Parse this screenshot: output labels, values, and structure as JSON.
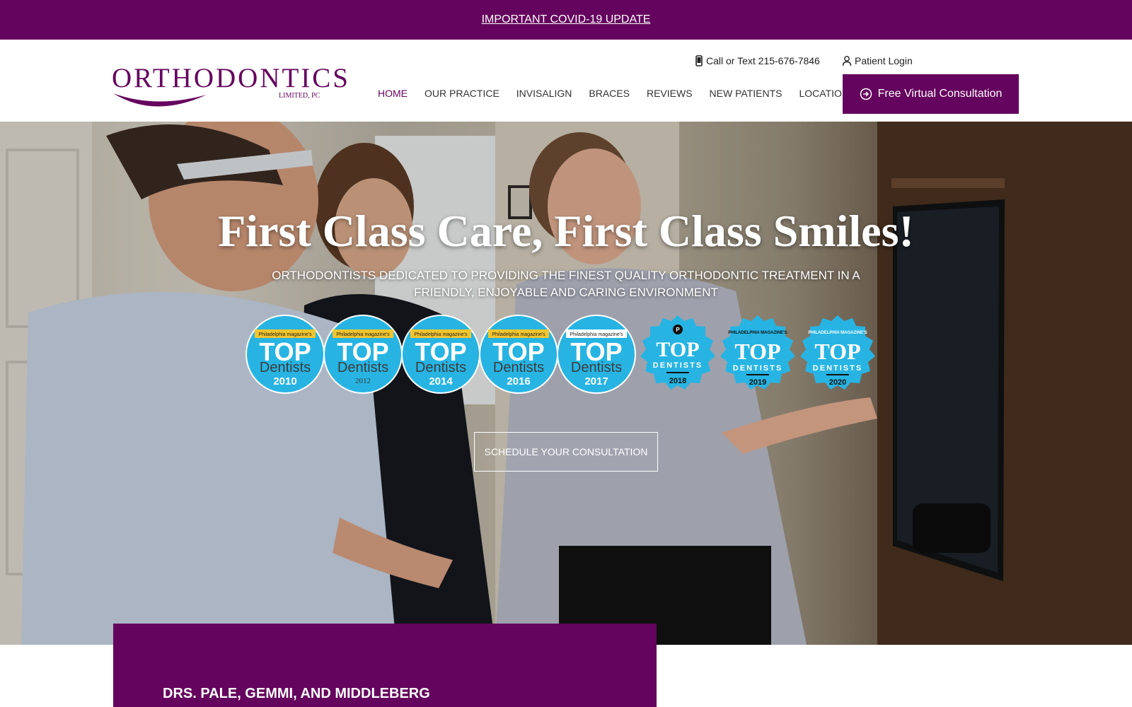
{
  "announcement": {
    "label": "IMPORTANT COVID-19 UPDATE"
  },
  "brand": {
    "logo_main": "ORTHODONTICS",
    "logo_sub": "LIMITED, PC",
    "primary_color": "#65045e",
    "badge_color": "#27b4e3",
    "badge_gold": "#f2c52e"
  },
  "utility": {
    "call_label": "Call or Text 215-676-7846",
    "call_icon": "phone-icon",
    "login_label": "Patient Login",
    "login_icon": "user-icon"
  },
  "nav": {
    "items": [
      {
        "label": "HOME",
        "active": true
      },
      {
        "label": "OUR PRACTICE"
      },
      {
        "label": "INVISALIGN"
      },
      {
        "label": "BRACES"
      },
      {
        "label": "REVIEWS"
      },
      {
        "label": "NEW PATIENTS"
      },
      {
        "label": "LOCATIONS"
      }
    ],
    "cta_label": "Free Virtual Consultation",
    "cta_icon": "arrow-circle-icon"
  },
  "hero": {
    "title": "First Class Care, First Class Smiles!",
    "subtitle": "ORTHODONTISTS DEDICATED TO PROVIDING THE FINEST QUALITY ORTHODONTIC TREATMENT IN A FRIENDLY, ENJOYABLE AND CARING ENVIRONMENT",
    "button_label": "SCHEDULE YOUR CONSULTATION",
    "badges": [
      {
        "publisher": "Philadelphia magazine's",
        "top": "TOP",
        "word": "Dentists",
        "year": "2010"
      },
      {
        "publisher": "Philadelphia magazine's",
        "top": "TOP",
        "word": "Dentists",
        "year": "2012"
      },
      {
        "publisher": "Philadelphia magazine's",
        "top": "TOP",
        "word": "Dentists",
        "year": "2014"
      },
      {
        "publisher": "Philadelphia magazine's",
        "top": "TOP",
        "word": "Dentists",
        "year": "2016"
      },
      {
        "publisher": "Philadelphia magazine's",
        "top": "TOP",
        "word": "Dentists",
        "year": "2017"
      },
      {
        "publisher": "P",
        "top": "TOP",
        "word": "DENTISTS",
        "year": "2018"
      },
      {
        "publisher": "PHILADELPHIA MAGAZINE'S",
        "top": "TOP",
        "word": "DENTISTS",
        "year": "2019"
      },
      {
        "publisher": "PHILADELPHIA MAGAZINE'S",
        "top": "TOP",
        "word": "DENTISTS",
        "year": "2020"
      }
    ]
  },
  "about": {
    "heading": "DRS. PALE, GEMMI, AND MIDDLEBERG"
  }
}
